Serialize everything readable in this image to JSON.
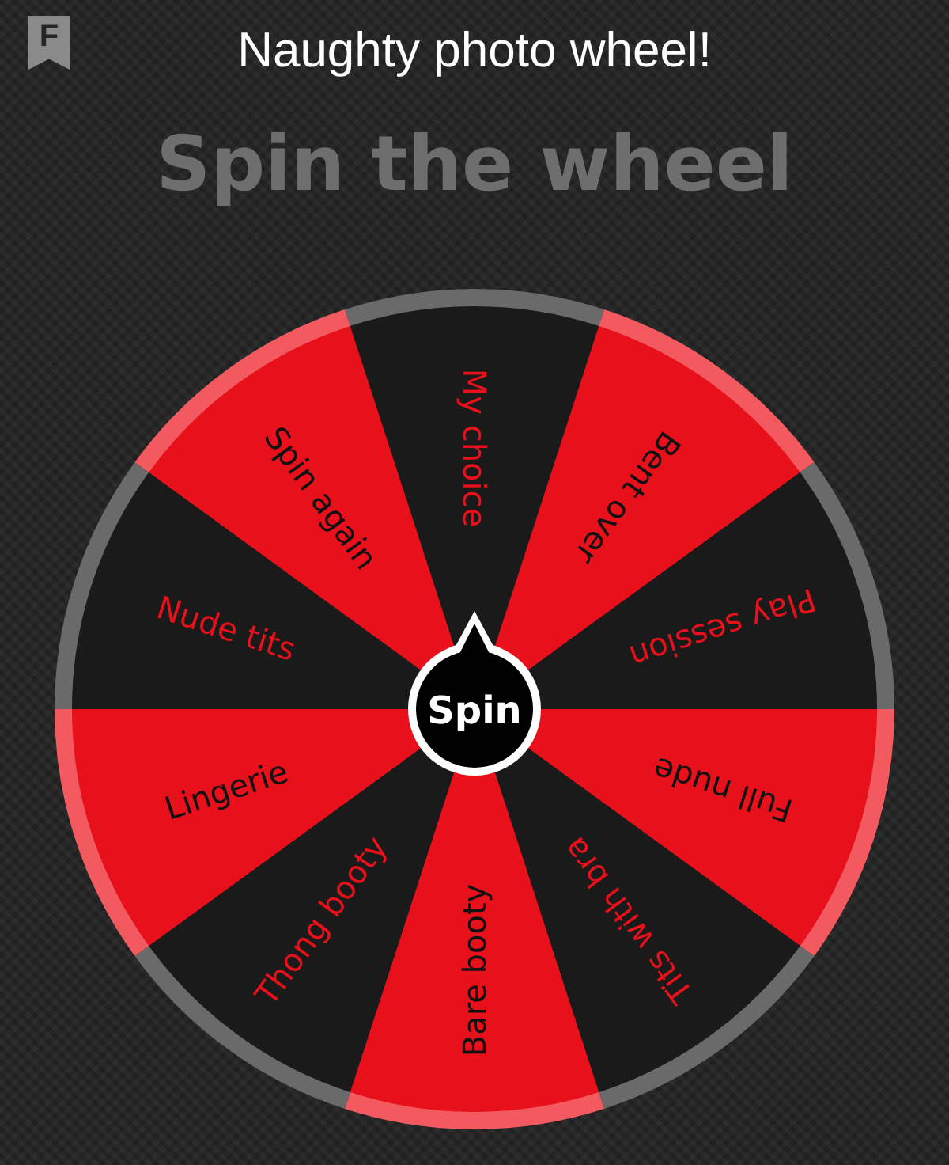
{
  "header": {
    "badge_letter": "F",
    "title": "Naughty photo wheel!"
  },
  "heading": "Spin the wheel",
  "wheel": {
    "segments": [
      {
        "label": "My choice",
        "color": "#1a1a1a"
      },
      {
        "label": "Bent over",
        "color": "#e8101a"
      },
      {
        "label": "Play session",
        "color": "#1a1a1a"
      },
      {
        "label": "Full nude",
        "color": "#e8101a"
      },
      {
        "label": "Tits with bra",
        "color": "#1a1a1a"
      },
      {
        "label": "Bare booty",
        "color": "#e8101a"
      },
      {
        "label": "Thong booty",
        "color": "#1a1a1a"
      },
      {
        "label": "Lingerie",
        "color": "#e8101a"
      },
      {
        "label": "Nude tits",
        "color": "#1a1a1a"
      },
      {
        "label": "Spin again",
        "color": "#e8101a"
      }
    ],
    "spin_button": "Spin"
  }
}
